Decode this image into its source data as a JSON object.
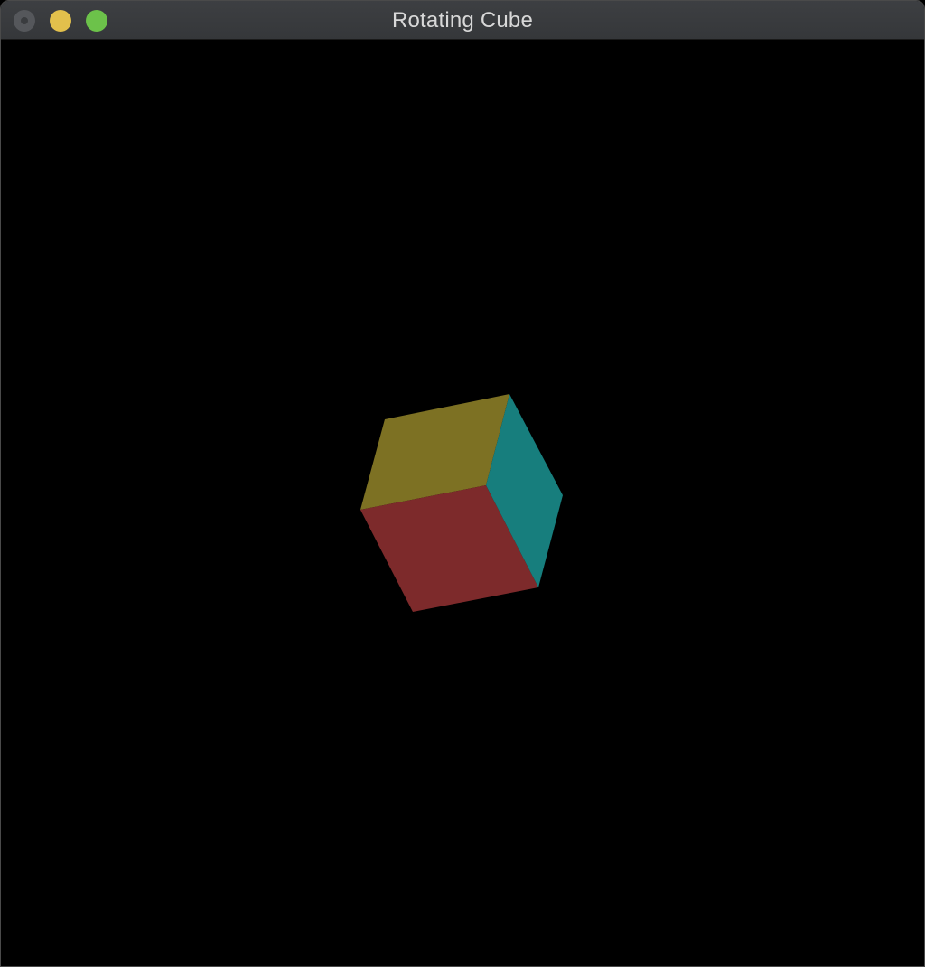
{
  "window": {
    "title": "Rotating Cube",
    "controls": {
      "close_icon": "close-icon",
      "minimize_icon": "minimize-icon",
      "zoom_icon": "zoom-icon"
    },
    "colors": {
      "titlebar": "#3a3c3f",
      "close": "#55575b",
      "minimize": "#e2c04c",
      "zoom": "#6cc24a",
      "background": "#000000"
    }
  },
  "scene": {
    "object": "cube",
    "faces": [
      {
        "name": "top",
        "color": "#7d7123"
      },
      {
        "name": "front",
        "color": "#7d2a2b"
      },
      {
        "name": "right",
        "color": "#177e7d"
      }
    ]
  }
}
